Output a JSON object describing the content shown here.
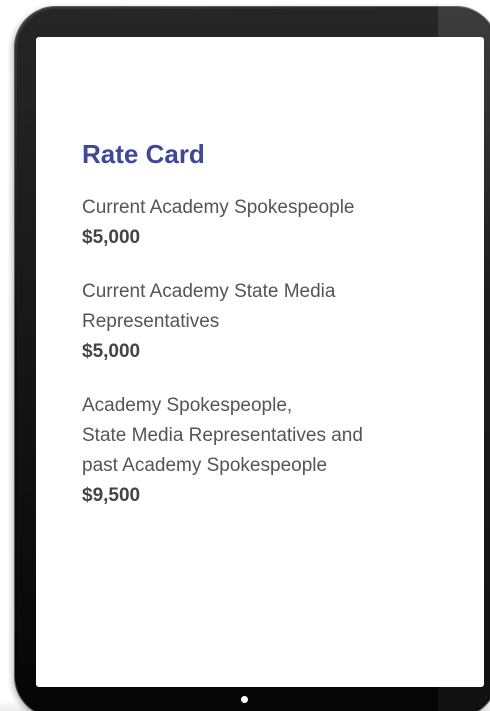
{
  "card": {
    "title": "Rate Card",
    "items": [
      {
        "label": "Current Academy Spokespeople",
        "price": "$5,000"
      },
      {
        "label": "Current Academy State Media\nRepresentatives",
        "price": "$5,000"
      },
      {
        "label": "Academy Spokespeople,\nState Media Representatives and\npast Academy Spokespeople",
        "price": "$9,500"
      }
    ]
  },
  "colors": {
    "title": "#3f4799",
    "text": "#555555",
    "bezel": "#000000",
    "screen": "#ffffff"
  },
  "icons": {
    "home_button": "home-dot-icon"
  }
}
